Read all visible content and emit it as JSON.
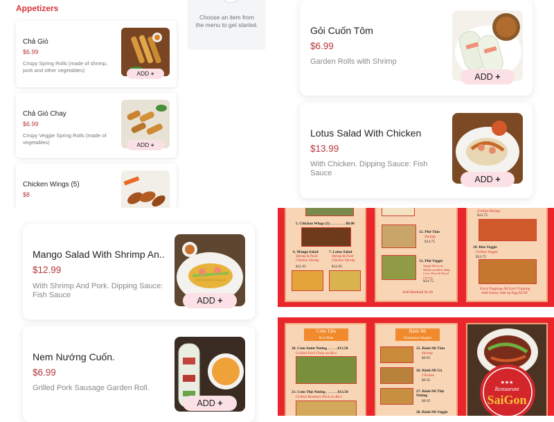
{
  "appetizers": {
    "title": "Appetizers",
    "items": [
      {
        "name": "Chả Giò",
        "price": "$6.99",
        "desc": "Crispy Spring Rolls (made of shrimp, pork and other vegetables)",
        "add": "ADD"
      },
      {
        "name": "Chả Giò Chay",
        "price": "$6.99",
        "desc": "Crispy Veggie Spring Rolls (made of vegetables)",
        "add": "ADD"
      },
      {
        "name": "Chicken Wings (5)",
        "price": "$8",
        "desc": "",
        "add": ""
      }
    ]
  },
  "empty_panel": {
    "text": "Choose an item from the menu to get started."
  },
  "right_cards": [
    {
      "name": "Gỏi Cuốn Tôm",
      "price": "$6.99",
      "desc": "Garden Rolls with Shrimp",
      "add": "ADD"
    },
    {
      "name": "Lotus Salad With Chicken",
      "price": "$13.99",
      "desc": "With Chicken. Dipping Sauce: Fish Sauce",
      "add": "ADD"
    }
  ],
  "left_cards": [
    {
      "name": "Mango Salad With Shrimp An...",
      "price": "$12.99",
      "desc": "With Shrimp And Pork. Dipping Sauce: Fish Sauce",
      "add": "ADD"
    },
    {
      "name": "Nem Nướng Cuốn.",
      "price": "$6.99",
      "desc": "Grilled Pork Sausage Garden Roll.",
      "add": "ADD"
    }
  ],
  "menu_top": {
    "col1": {
      "item5": "5. Chicken Wings (5) . . . . . . . . $8.00",
      "item6": "6. Mango Salad",
      "item6_sub": "Shrimp & Pork/ Chicken/ Shrimp",
      "item6_price": "$11.95",
      "item7": "7. Lotus Salad",
      "item7_sub": "Shrimp & Pork/ Chicken/ Shrimp",
      "item7_price": "$12.95"
    },
    "col2": {
      "item12": "12. Phở Tôm",
      "item12_sub": "Shrimp",
      "item12_price": "$14.75",
      "item13": "13. Phở Veggie",
      "item13_sub": "Veggie Broccoli, Mushroom/Bok, Baby Corn, Peas & Diced Carrots",
      "item13_price": "$14.75",
      "note": "Add Meatball $1.00"
    },
    "col3": {
      "top": "Grilled Shrimp",
      "top_price": "$13.75",
      "item18": "18. Bún Veggie",
      "item18_sub": "Grilled Veggie",
      "item18_price": "$13.75",
      "extra": "Extra Toppings $4 Each Topping",
      "extra2": "Add Sunny-side up Egg $3.00"
    }
  },
  "menu_bottom": {
    "col1": {
      "banner": "Cơm Tấm",
      "banner_sub": "Rice Plate",
      "item20": "20. Cơm Sườn Nướng . . . . . $13.50",
      "item20_sub": "Grilled Pork Chop on Rice",
      "item21": "21. Cơm Thịt Nướng . . . . . . $13.50",
      "item21_sub": "Grilled Boneless Pork on Rice"
    },
    "col2": {
      "banner": "Bánh Mì",
      "banner_sub": "Vietnamese Hoagies",
      "item25": "25. Bánh Mì Tôm",
      "item25_sub": "Shrimp",
      "item25_price": "$9.95",
      "item26": "26. Bánh Mì Gà",
      "item26_sub": "Chicken",
      "item26_price": "$9.95",
      "item27": "27. Bánh Mì Thịt Nướng",
      "item27_price": "$9.95",
      "item28": "28. Bánh Mì Veggie"
    },
    "logo": {
      "stars": "★★★",
      "top": "Restaurant",
      "main": "SaiGon"
    }
  }
}
